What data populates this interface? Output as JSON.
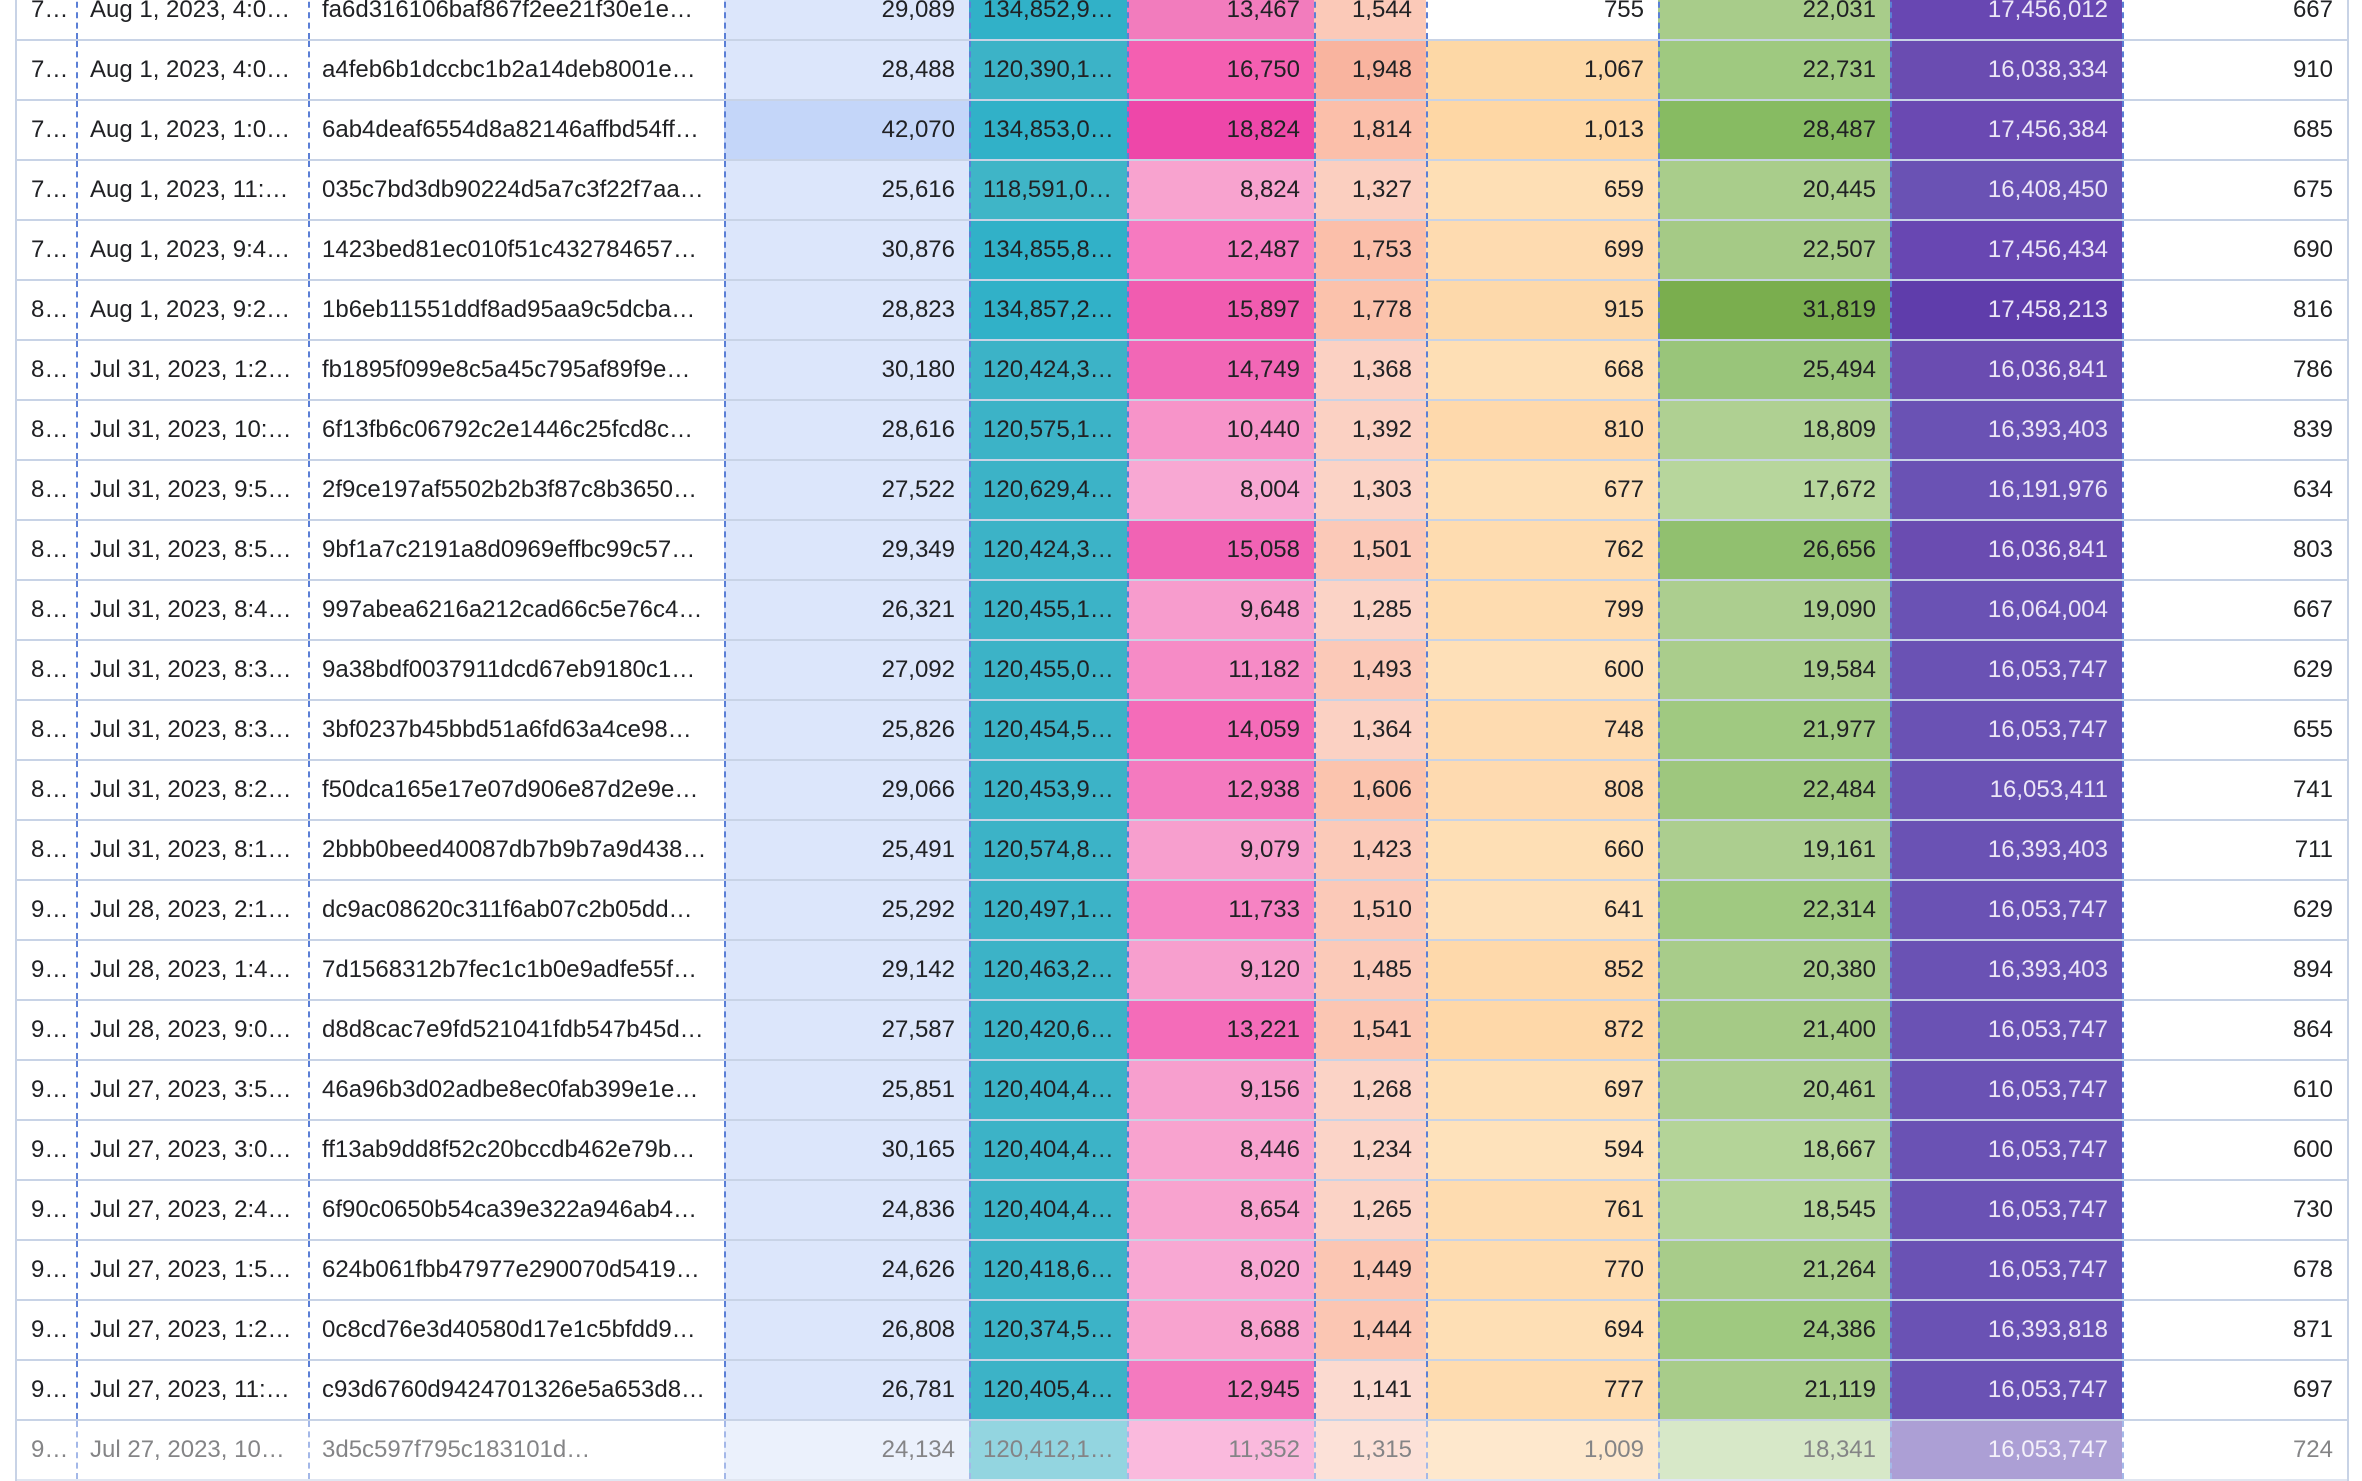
{
  "table": {
    "rows": [
      [
        "7…",
        "Aug 1, 2023, 4:0…",
        "fa6d316106baf867f2ee21f30e1e…",
        "29,089",
        "134,852,9…",
        "13,467",
        "1,544",
        "755",
        "22,031",
        "17,456,012",
        "667"
      ],
      [
        "7…",
        "Aug 1, 2023, 4:0…",
        "a4feb6b1dccbc1b2a14deb8001e…",
        "28,488",
        "120,390,1…",
        "16,750",
        "1,948",
        "1,067",
        "22,731",
        "16,038,334",
        "910"
      ],
      [
        "7…",
        "Aug 1, 2023, 1:0…",
        "6ab4deaf6554d8a82146affbd54ff…",
        "42,070",
        "134,853,0…",
        "18,824",
        "1,814",
        "1,013",
        "28,487",
        "17,456,384",
        "685"
      ],
      [
        "7…",
        "Aug 1, 2023, 11:…",
        "035c7bd3db90224d5a7c3f22f7aa…",
        "25,616",
        "118,591,0…",
        "8,824",
        "1,327",
        "659",
        "20,445",
        "16,408,450",
        "675"
      ],
      [
        "7…",
        "Aug 1, 2023, 9:4…",
        "1423bed81ec010f51c432784657…",
        "30,876",
        "134,855,8…",
        "12,487",
        "1,753",
        "699",
        "22,507",
        "17,456,434",
        "690"
      ],
      [
        "8…",
        "Aug 1, 2023, 9:2…",
        "1b6eb11551ddf8ad95aa9c5dcba…",
        "28,823",
        "134,857,2…",
        "15,897",
        "1,778",
        "915",
        "31,819",
        "17,458,213",
        "816"
      ],
      [
        "8…",
        "Jul 31, 2023, 1:2…",
        "fb1895f099e8c5a45c795af89f9e…",
        "30,180",
        "120,424,3…",
        "14,749",
        "1,368",
        "668",
        "25,494",
        "16,036,841",
        "786"
      ],
      [
        "8…",
        "Jul 31, 2023, 10:…",
        "6f13fb6c06792c2e1446c25fcd8c…",
        "28,616",
        "120,575,1…",
        "10,440",
        "1,392",
        "810",
        "18,809",
        "16,393,403",
        "839"
      ],
      [
        "8…",
        "Jul 31, 2023, 9:5…",
        "2f9ce197af5502b2b3f87c8b3650…",
        "27,522",
        "120,629,4…",
        "8,004",
        "1,303",
        "677",
        "17,672",
        "16,191,976",
        "634"
      ],
      [
        "8…",
        "Jul 31, 2023, 8:5…",
        "9bf1a7c2191a8d0969effbc99c57…",
        "29,349",
        "120,424,3…",
        "15,058",
        "1,501",
        "762",
        "26,656",
        "16,036,841",
        "803"
      ],
      [
        "8…",
        "Jul 31, 2023, 8:4…",
        "997abea6216a212cad66c5e76c4…",
        "26,321",
        "120,455,1…",
        "9,648",
        "1,285",
        "799",
        "19,090",
        "16,064,004",
        "667"
      ],
      [
        "8…",
        "Jul 31, 2023, 8:3…",
        "9a38bdf0037911dcd67eb9180c1…",
        "27,092",
        "120,455,0…",
        "11,182",
        "1,493",
        "600",
        "19,584",
        "16,053,747",
        "629"
      ],
      [
        "8…",
        "Jul 31, 2023, 8:3…",
        "3bf0237b45bbd51a6fd63a4ce98…",
        "25,826",
        "120,454,5…",
        "14,059",
        "1,364",
        "748",
        "21,977",
        "16,053,747",
        "655"
      ],
      [
        "8…",
        "Jul 31, 2023, 8:2…",
        "f50dca165e17e07d906e87d2e9e…",
        "29,066",
        "120,453,9…",
        "12,938",
        "1,606",
        "808",
        "22,484",
        "16,053,411",
        "741"
      ],
      [
        "8…",
        "Jul 31, 2023, 8:1…",
        "2bbb0beed40087db7b9b7a9d438…",
        "25,491",
        "120,574,8…",
        "9,079",
        "1,423",
        "660",
        "19,161",
        "16,393,403",
        "711"
      ],
      [
        "9…",
        "Jul 28, 2023, 2:1…",
        "dc9ac08620c311f6ab07c2b05dd…",
        "25,292",
        "120,497,1…",
        "11,733",
        "1,510",
        "641",
        "22,314",
        "16,053,747",
        "629"
      ],
      [
        "9…",
        "Jul 28, 2023, 1:4…",
        "7d1568312b7fec1c1b0e9adfe55f…",
        "29,142",
        "120,463,2…",
        "9,120",
        "1,485",
        "852",
        "20,380",
        "16,393,403",
        "894"
      ],
      [
        "9…",
        "Jul 28, 2023, 9:0…",
        "d8d8cac7e9fd521041fdb547b45d…",
        "27,587",
        "120,420,6…",
        "13,221",
        "1,541",
        "872",
        "21,400",
        "16,053,747",
        "864"
      ],
      [
        "9…",
        "Jul 27, 2023, 3:5…",
        "46a96b3d02adbe8ec0fab399e1e…",
        "25,851",
        "120,404,4…",
        "9,156",
        "1,268",
        "697",
        "20,461",
        "16,053,747",
        "610"
      ],
      [
        "9…",
        "Jul 27, 2023, 3:0…",
        "ff13ab9dd8f52c20bccdb462e79b…",
        "30,165",
        "120,404,4…",
        "8,446",
        "1,234",
        "594",
        "18,667",
        "16,053,747",
        "600"
      ],
      [
        "9…",
        "Jul 27, 2023, 2:4…",
        "6f90c0650b54ca39e322a946ab4…",
        "24,836",
        "120,404,4…",
        "8,654",
        "1,265",
        "761",
        "18,545",
        "16,053,747",
        "730"
      ],
      [
        "9…",
        "Jul 27, 2023, 1:5…",
        "624b061fbb47977e290070d5419…",
        "24,626",
        "120,418,6…",
        "8,020",
        "1,449",
        "770",
        "21,264",
        "16,053,747",
        "678"
      ],
      [
        "9…",
        "Jul 27, 2023, 1:2…",
        "0c8cd76e3d40580d17e1c5bfdd9…",
        "26,808",
        "120,374,5…",
        "8,688",
        "1,444",
        "694",
        "24,386",
        "16,393,818",
        "871"
      ],
      [
        "9…",
        "Jul 27, 2023, 11:…",
        "c93d6760d9424701326e5a653d8…",
        "26,781",
        "120,405,4…",
        "12,945",
        "1,141",
        "777",
        "21,119",
        "16,053,747",
        "697"
      ],
      [
        "9…",
        "Jul 27, 2023, 10…",
        "3d5c597f795c183101d…",
        "24,134",
        "120,412,1…",
        "11,352",
        "1,315",
        "1,009",
        "18,341",
        "16,053,747",
        "724"
      ]
    ],
    "cell_colors": [
      [
        null,
        null,
        null,
        "#dce6fb",
        "#31b1c8",
        "#f27cbd",
        "#fbc9b8",
        null,
        "#a8cc8a",
        "#6847b2",
        null
      ],
      [
        null,
        null,
        null,
        "#dce6fb",
        "#3cb3c7",
        "#f45fb1",
        "#f9b49f",
        "#fdd8a6",
        "#9fc980",
        "#6a4cb1",
        null
      ],
      [
        null,
        null,
        null,
        "#c4d6f9",
        "#31b1c8",
        "#ee47a9",
        "#fbbfaa",
        "#fed7a5",
        "#87bb62",
        "#6a49b2",
        null
      ],
      [
        null,
        null,
        null,
        "#dce6fb",
        "#3fb5c7",
        "#f8a3cf",
        "#fbcfc0",
        "#fedfb5",
        "#a9cd8b",
        "#6a52b4",
        null
      ],
      [
        null,
        null,
        null,
        "#dce6fb",
        "#31b1c8",
        "#f67ac0",
        "#fbbfaa",
        "#fedbb0",
        "#a5ca86",
        "#6847b2",
        null
      ],
      [
        null,
        null,
        null,
        "#dce6fb",
        "#31b1c8",
        "#f15cb0",
        "#fbc2ac",
        "#fdd9ab",
        "#7aae4e",
        "#5f3dab",
        null
      ],
      [
        null,
        null,
        null,
        "#dce6fb",
        "#3cb3c7",
        "#f267b6",
        "#fbd1c3",
        "#fedfb5",
        "#99c57a",
        "#6a4cb1",
        null
      ],
      [
        null,
        null,
        null,
        "#dce6fb",
        "#3cb3c7",
        "#f794c9",
        "#fbd1c3",
        "#fed9ac",
        "#afd092",
        "#6a52b4",
        null
      ],
      [
        null,
        null,
        null,
        "#dce6fb",
        "#3cb3c7",
        "#f8a8d3",
        "#fbd3c6",
        "#fedfb5",
        "#b7d69c",
        "#6a52b4",
        null
      ],
      [
        null,
        null,
        null,
        "#dce6fb",
        "#3cb3c7",
        "#f163b4",
        "#fbc9b8",
        "#fedcb0",
        "#91c06f",
        "#6a4cb1",
        null
      ],
      [
        null,
        null,
        null,
        "#dce6fb",
        "#3cb3c7",
        "#f79ccd",
        "#fbd3c6",
        "#fedcb0",
        "#acce8f",
        "#6a52b4",
        null
      ],
      [
        null,
        null,
        null,
        "#dce6fb",
        "#3cb3c7",
        "#f68bc6",
        "#fbc9b8",
        "#fee0b8",
        "#aacd8c",
        "#6a52b4",
        null
      ],
      [
        null,
        null,
        null,
        "#dce6fb",
        "#3cb3c7",
        "#f46cb9",
        "#fbd1c3",
        "#fedbb0",
        "#a0c981",
        "#6a52b4",
        null
      ],
      [
        null,
        null,
        null,
        "#dce6fb",
        "#3cb3c7",
        "#f47abf",
        "#fbc4ae",
        "#fedab0",
        "#9ec77e",
        "#6a52b4",
        null
      ],
      [
        null,
        null,
        null,
        "#dce6fb",
        "#3cb3c7",
        "#f79fce",
        "#fbcab9",
        "#fedfb5",
        "#acce8f",
        "#6a52b4",
        null
      ],
      [
        null,
        null,
        null,
        "#dce6fb",
        "#3cb3c7",
        "#f683c3",
        "#fbc9b8",
        "#fee0b8",
        "#a0c981",
        "#6a52b4",
        null
      ],
      [
        null,
        null,
        null,
        "#dce6fb",
        "#3cb3c7",
        "#f79fce",
        "#fbcab9",
        "#fed9ab",
        "#a8cc8a",
        "#6a52b4",
        null
      ],
      [
        null,
        null,
        null,
        "#dce6fb",
        "#3cb3c7",
        "#f46cb9",
        "#fbc6b3",
        "#fed8a9",
        "#a5ca86",
        "#6a52b4",
        null
      ],
      [
        null,
        null,
        null,
        "#dce6fb",
        "#3cb3c7",
        "#f79fce",
        "#fbd3c6",
        "#fedfb5",
        "#acce8f",
        "#6a52b4",
        null
      ],
      [
        null,
        null,
        null,
        "#dce6fb",
        "#3cb3c7",
        "#f8a3cf",
        "#fbd4c8",
        "#fee2bb",
        "#b4d498",
        "#6a52b4",
        null
      ],
      [
        null,
        null,
        null,
        "#dce6fb",
        "#3cb3c7",
        "#f8a3cf",
        "#fbd3c6",
        "#fedcb0",
        "#b4d498",
        "#6a52b4",
        null
      ],
      [
        null,
        null,
        null,
        "#dce6fb",
        "#3cb3c7",
        "#f8a8d3",
        "#fbc6b3",
        "#fedcb0",
        "#a8cc8a",
        "#6a52b4",
        null
      ],
      [
        null,
        null,
        null,
        "#dce6fb",
        "#3cb3c7",
        "#f8a3cf",
        "#fbc6b3",
        "#fedfb5",
        "#9fc980",
        "#6a52b4",
        null
      ],
      [
        null,
        null,
        null,
        "#dce6fb",
        "#3cb3c7",
        "#f47abf",
        "#fbdad0",
        "#fedcb0",
        "#a8cc8a",
        "#6a52b4",
        null
      ],
      [
        null,
        null,
        null,
        "#dce6fb",
        "#3cb3c7",
        "#f683c3",
        "#fbcab9",
        "#fed7a5",
        "#b7d69c",
        "#6a52b4",
        null
      ]
    ],
    "text_colors": [
      "#202124",
      "#202124",
      "#202124",
      "#202124",
      "#202124",
      "#202124",
      "#202124",
      "#202124",
      "#202124",
      "#ece6f7",
      "#202124"
    ]
  }
}
